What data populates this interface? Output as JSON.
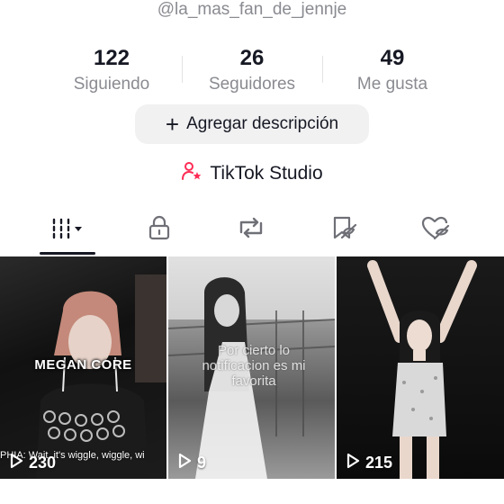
{
  "profile": {
    "username": "@la_mas_fan_de_jennje"
  },
  "stats": {
    "following": {
      "value": "122",
      "label": "Siguiendo"
    },
    "followers": {
      "value": "26",
      "label": "Seguidores"
    },
    "likes": {
      "value": "49",
      "label": "Me gusta"
    }
  },
  "actions": {
    "add_description": "Agregar descripción",
    "studio": "TikTok Studio"
  },
  "tabs": [
    {
      "icon": "grid-icon",
      "selected": true
    },
    {
      "icon": "lock-icon",
      "selected": false
    },
    {
      "icon": "repost-icon",
      "selected": false
    },
    {
      "icon": "bookmark-hidden-icon",
      "selected": false
    },
    {
      "icon": "heart-hidden-icon",
      "selected": false
    }
  ],
  "videos": [
    {
      "views": "230",
      "overlay": "MEGAN CORE",
      "caption": "PHIA: Wait, it's wiggle, wiggle, wi"
    },
    {
      "views": "9",
      "overlay": "Por cierto lo notificacion es mi favorita"
    },
    {
      "views": "215"
    }
  ],
  "colors": {
    "studio_icon": "#fe2c55",
    "secondary_text": "#8a8b91",
    "button_bg": "#f1f1f2"
  }
}
